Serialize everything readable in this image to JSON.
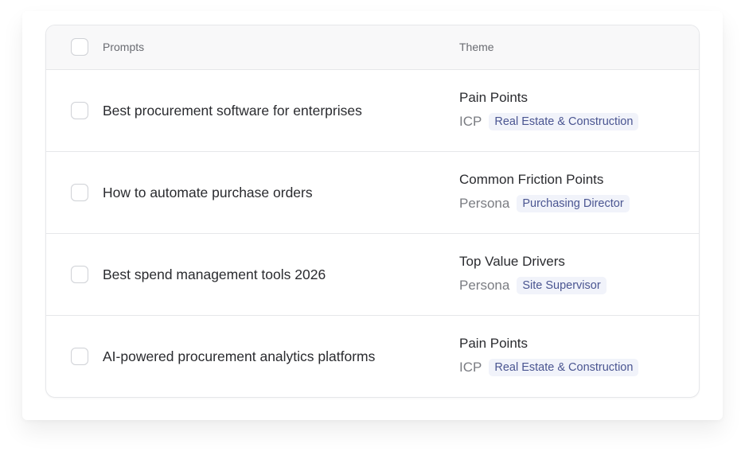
{
  "table": {
    "headers": {
      "prompts": "Prompts",
      "theme": "Theme"
    },
    "rows": [
      {
        "prompt": "Best procurement software for enterprises",
        "theme": "Pain Points",
        "meta_label": "ICP",
        "meta_tag": "Real Estate & Construction"
      },
      {
        "prompt": "How to automate purchase orders",
        "theme": "Common Friction Points",
        "meta_label": "Persona",
        "meta_tag": "Purchasing Director"
      },
      {
        "prompt": "Best spend management tools 2026",
        "theme": "Top Value Drivers",
        "meta_label": "Persona",
        "meta_tag": "Site Supervisor"
      },
      {
        "prompt": "AI-powered procurement analytics platforms",
        "theme": "Pain Points",
        "meta_label": "ICP",
        "meta_tag": "Real Estate & Construction"
      }
    ]
  },
  "colors": {
    "tag_background": "#f1f3fa",
    "tag_text": "#4a5591",
    "border": "#e6e7ea"
  }
}
